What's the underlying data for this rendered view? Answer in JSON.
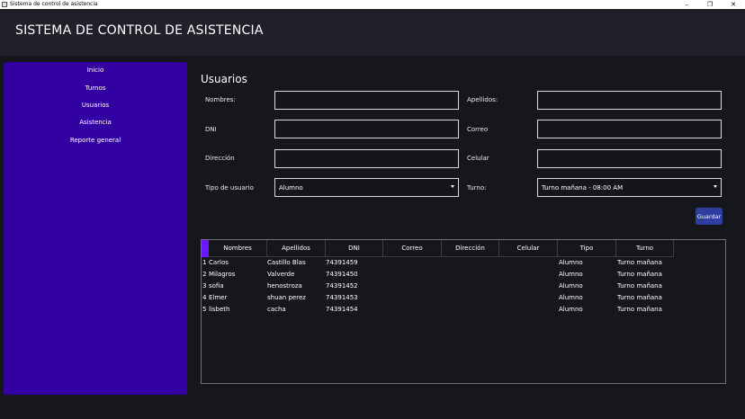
{
  "window": {
    "title": "Sistema de control de asistencia",
    "controls": {
      "minimize": "–",
      "maximize": "❐",
      "close": "✕"
    }
  },
  "header": {
    "title": "SISTEMA DE CONTROL DE ASISTENCIA"
  },
  "sidebar": {
    "items": [
      {
        "label": "Inicio"
      },
      {
        "label": "Turnos"
      },
      {
        "label": "Usuarios"
      },
      {
        "label": "Asistencia"
      },
      {
        "label": "Reporte general"
      }
    ]
  },
  "form": {
    "title": "Usuarios",
    "labels": {
      "nombres": "Nombres:",
      "apellidos": "Apellidos:",
      "dni": "DNI",
      "correo": "Correo",
      "direccion": "Dirección",
      "celular": "Celular",
      "tipo_usuario": "Tipo de usuario",
      "turno": "Turno:"
    },
    "values": {
      "nombres": "",
      "apellidos": "",
      "dni": "",
      "correo": "",
      "direccion": "",
      "celular": ""
    },
    "tipo_usuario_selected": "Alumno",
    "turno_selected": "Turno mañana - 08:00 AM",
    "save_label": "Guardar"
  },
  "table": {
    "columns": [
      "Nombres",
      "Apellidos",
      "DNI",
      "Correo",
      "Dirección",
      "Celular",
      "Tipo",
      "Turno"
    ],
    "rows": [
      {
        "num": "1",
        "nombres": "Carlos",
        "apellidos": "Castillo Blas",
        "dni": "74391459",
        "correo": "",
        "direccion": "",
        "celular": "",
        "tipo": "Alumno",
        "turno": "Turno mañana"
      },
      {
        "num": "2",
        "nombres": "Milagros",
        "apellidos": "Valverde",
        "dni": "74391450",
        "correo": "",
        "direccion": "",
        "celular": "",
        "tipo": "Alumno",
        "turno": "Turno mañana"
      },
      {
        "num": "3",
        "nombres": "sofia",
        "apellidos": "henostroza",
        "dni": "74391452",
        "correo": "",
        "direccion": "",
        "celular": "",
        "tipo": "Alumno",
        "turno": "Turno mañana"
      },
      {
        "num": "4",
        "nombres": "Elmer",
        "apellidos": "shuan perez",
        "dni": "74391453",
        "correo": "",
        "direccion": "",
        "celular": "",
        "tipo": "Alumno",
        "turno": "Turno mañana"
      },
      {
        "num": "5",
        "nombres": "lisbeth",
        "apellidos": "cacha",
        "dni": "74391454",
        "correo": "",
        "direccion": "",
        "celular": "",
        "tipo": "Alumno",
        "turno": "Turno mañana"
      }
    ]
  },
  "colors": {
    "background": "#16161d",
    "header": "#1f2029",
    "sidebar": "#3300a2",
    "accent": "#6b17ff",
    "button": "#2e3d9e"
  }
}
